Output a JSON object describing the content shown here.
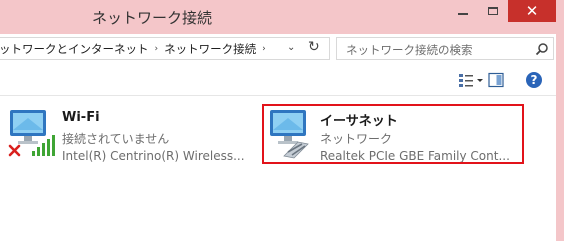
{
  "window": {
    "title": "ネットワーク接続",
    "close_glyph": "✕",
    "accent_color": "#f4c6c9",
    "close_color": "#c7302b"
  },
  "address_bar": {
    "crumbs": [
      "ットワークとインターネット",
      "ネットワーク接続"
    ],
    "separator": "›",
    "dropdown_glyph": "⌄",
    "refresh_glyph": "↻"
  },
  "search": {
    "placeholder": "ネットワーク接続の検索",
    "icon": "search-icon"
  },
  "toolbar": {
    "view_glyph": "▾",
    "help_glyph": "?"
  },
  "adapters": [
    {
      "name": "Wi-Fi",
      "status": "接続されていません",
      "device": "Intel(R) Centrino(R) Wireless...",
      "icon": "wifi-adapter-icon",
      "disconnected": true,
      "selected": false
    },
    {
      "name": "イーサネット",
      "status": "ネットワーク",
      "device": "Realtek PCIe GBE Family Cont...",
      "icon": "ethernet-adapter-icon",
      "disconnected": false,
      "selected": true
    }
  ],
  "highlight_color": "#e2131a"
}
